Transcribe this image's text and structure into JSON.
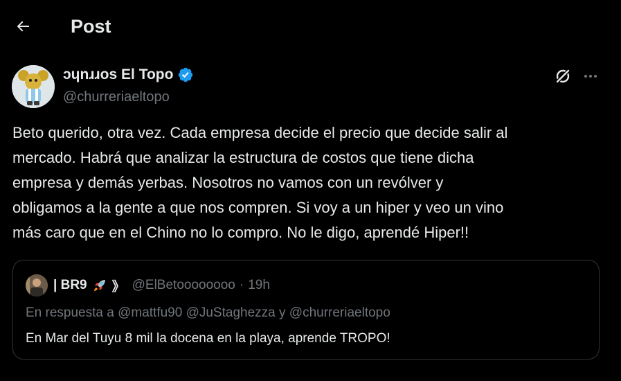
{
  "header": {
    "title": "Post"
  },
  "author": {
    "display_name": "ɔɥnɹɹos El Topo",
    "handle": "@churreriaeltopo",
    "verified_color": "#1d9bf0"
  },
  "tweet": {
    "text": "Beto querido, otra vez. Cada empresa decide el precio que decide salir al\nmercado. Habrá que analizar la estructura de costos que tiene dicha\nempresa y demás yerbas. Nosotros no vamos con un revólver y\nobligamos a la gente a que nos compren. Si voy a un hiper y veo un vino\nmás caro que en el Chino no lo compro. No le digo, aprendé Hiper!!"
  },
  "quote": {
    "name": "| BR9",
    "name_suffix": "》",
    "handle": "@ElBetoooooooo",
    "separator": "·",
    "time": "19h",
    "reply_to": "En respuesta a @mattfu90 @JuStaghezza y @churreriaeltopo",
    "text": "En Mar del Tuyu 8 mil la docena en la playa, aprende TROPO!"
  },
  "icons": {
    "back": "arrow-left-icon",
    "grok": "grok-icon",
    "more": "more-horizontal-icon",
    "verified": "verified-badge-icon",
    "emoji": "rocket-emoji-icon"
  },
  "colors": {
    "background": "#000000",
    "text_primary": "#e7e9ea",
    "text_secondary": "#71767b",
    "border": "#2f3336",
    "accent": "#1d9bf0"
  }
}
